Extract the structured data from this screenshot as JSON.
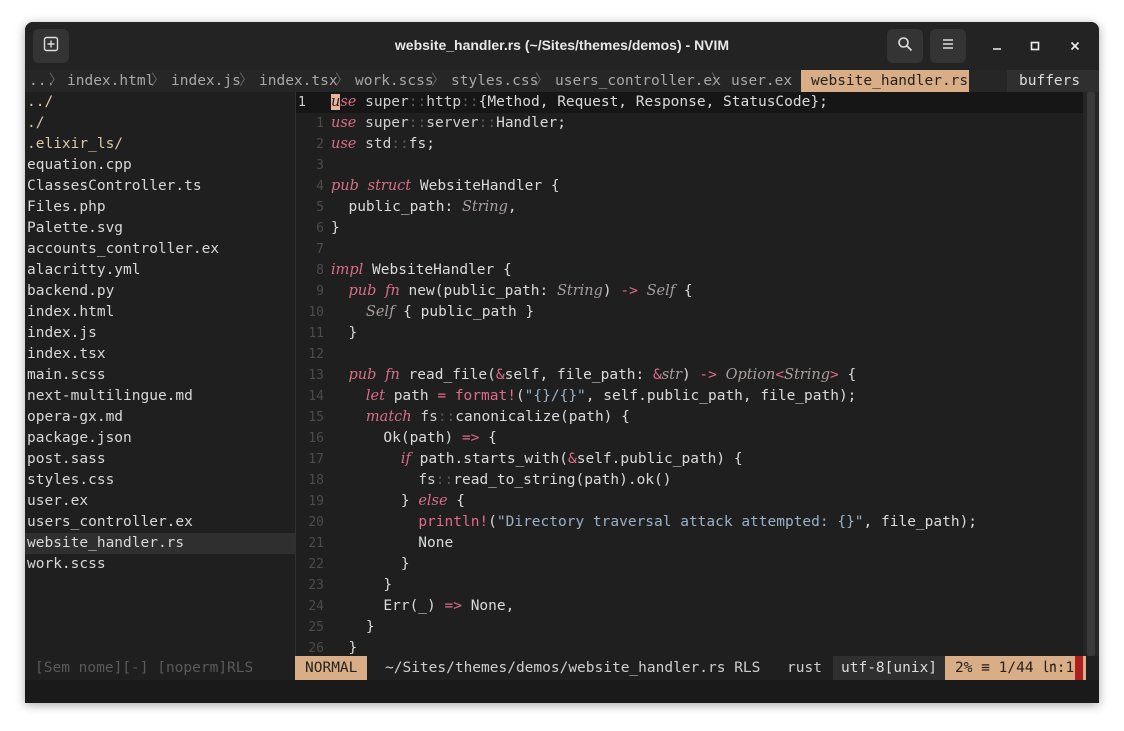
{
  "window": {
    "title": "website_handler.rs (~/Sites/themes/demos) - NVIM"
  },
  "icons": {
    "new_tab": "new-tab-icon",
    "search": "search-icon",
    "menu": "hamburger-menu-icon",
    "minimize": "minimize-icon",
    "maximize": "maximize-icon",
    "close": "close-icon"
  },
  "tabs": [
    "...",
    "index.html",
    "index.js",
    "index.tsx",
    "work.scss",
    "styles.css",
    "users_controller.ex",
    "user.ex"
  ],
  "active_tab": "website_handler.rs",
  "buffers_label": "buffers",
  "tree": {
    "items": [
      "../",
      "./",
      ".elixir_ls/",
      "equation.cpp",
      "ClassesController.ts",
      "Files.php",
      "Palette.svg",
      "accounts_controller.ex",
      "alacritty.yml",
      "backend.py",
      "index.html",
      "index.js",
      "index.tsx",
      "main.scss",
      "next-multilingue.md",
      "opera-gx.md",
      "package.json",
      "post.sass",
      "styles.css",
      "user.ex",
      "users_controller.ex",
      "website_handler.rs",
      "work.scss"
    ],
    "selected": "website_handler.rs"
  },
  "editor": {
    "line_numbers": [
      "1",
      "1",
      "2",
      "3",
      "4",
      "5",
      "6",
      "7",
      "8",
      "9",
      "10",
      "11",
      "12",
      "13",
      "14",
      "15",
      "16",
      "17",
      "18",
      "19",
      "20",
      "21",
      "22",
      "23",
      "24",
      "25",
      "26"
    ],
    "lines": [
      "use super::http::{Method, Request, Response, StatusCode};",
      "use super::server::Handler;",
      "use std::fs;",
      "",
      "pub struct WebsiteHandler {",
      "  public_path: String,",
      "}",
      "",
      "impl WebsiteHandler {",
      "  pub fn new(public_path: String) -> Self {",
      "    Self { public_path }",
      "  }",
      "",
      "  pub fn read_file(&self, file_path: &str) -> Option<String> {",
      "    let path = format!(\"{}/{}\", self.public_path, file_path);",
      "    match fs::canonicalize(path) {",
      "      Ok(path) => {",
      "        if path.starts_with(&self.public_path) {",
      "          fs::read_to_string(path).ok()",
      "        } else {",
      "          println!(\"Directory traversal attack attempted: {}\", file_path);",
      "          None",
      "        }",
      "      }",
      "      Err(_) => None,",
      "    }",
      "  }"
    ]
  },
  "status": {
    "left": "[Sem nome][-] [noperm]RLS",
    "mode": "NORMAL",
    "path": "~/Sites/themes/demos/website_handler.rs  RLS",
    "filetype": "rust",
    "encoding": "utf-8[unix]",
    "position": "2% ≡ 1/44 ㏑:1"
  },
  "colors": {
    "accent": "#d9ae87",
    "keyword": "#d96e86",
    "background": "#1f1f1f",
    "string": "#9ab0c8"
  }
}
